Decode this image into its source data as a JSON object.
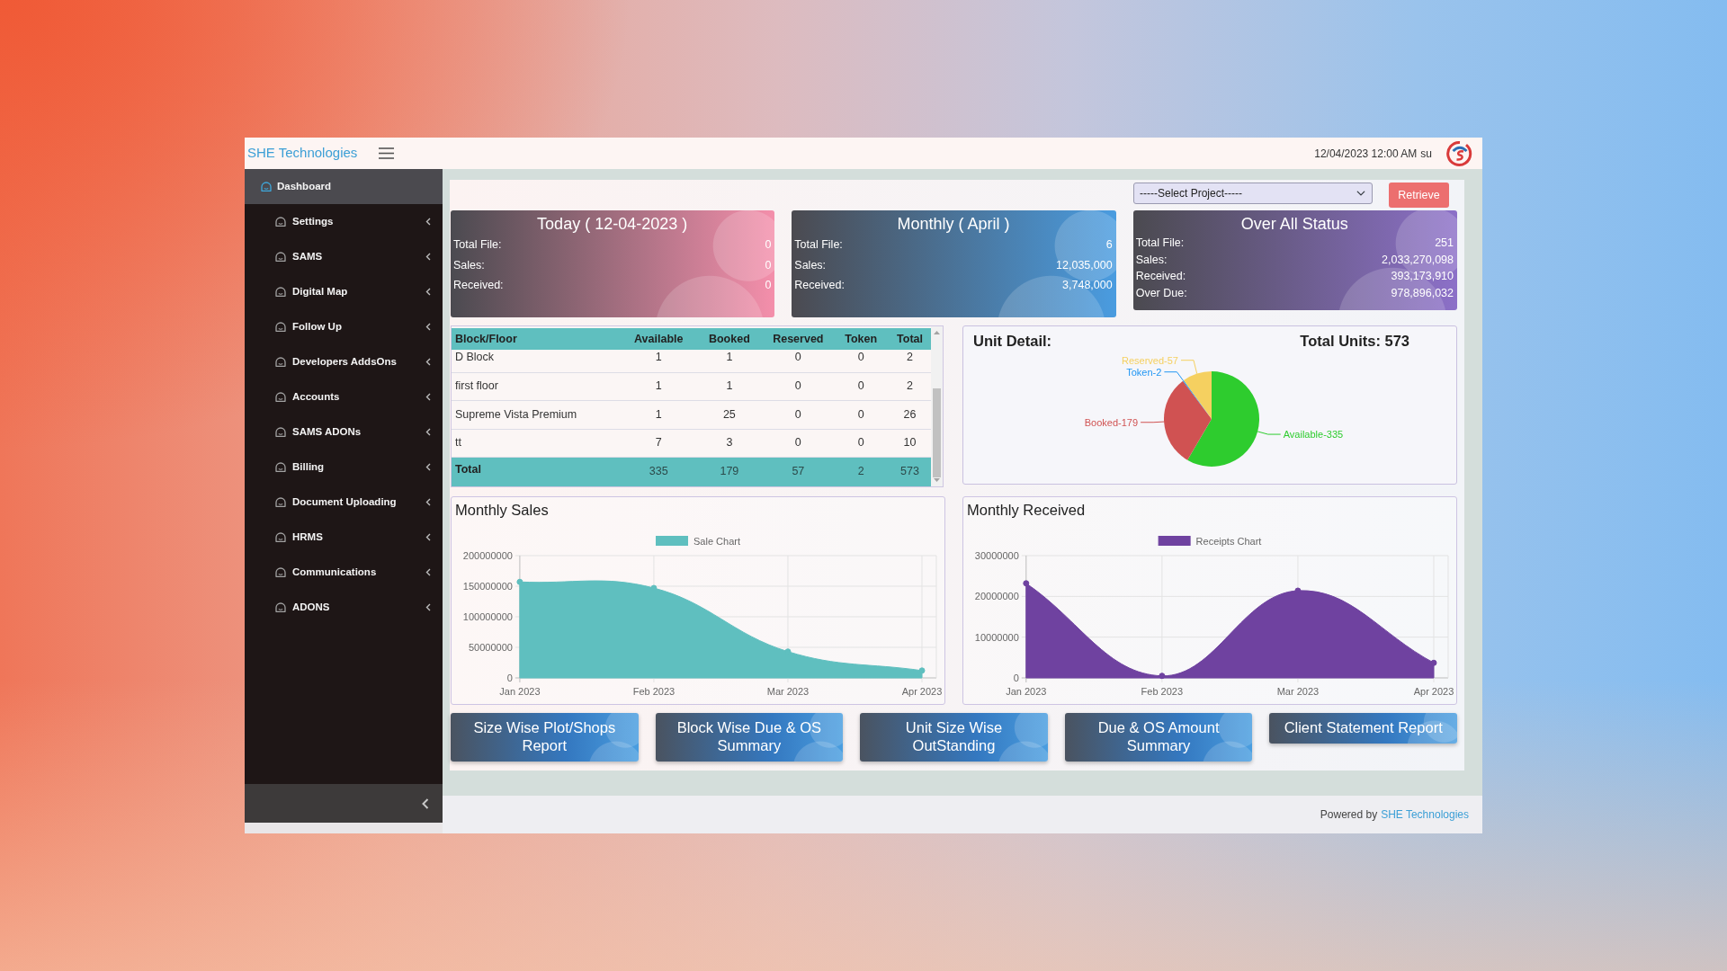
{
  "header": {
    "brand": "SHE Technologies",
    "datetime": "12/04/2023 12:00 AM",
    "user": "su"
  },
  "sidebar": {
    "items": [
      {
        "label": "Dashboard",
        "selected": true,
        "has_submenu": false
      },
      {
        "label": "Settings",
        "selected": false,
        "has_submenu": true
      },
      {
        "label": "SAMS",
        "selected": false,
        "has_submenu": true
      },
      {
        "label": "Digital Map",
        "selected": false,
        "has_submenu": true
      },
      {
        "label": "Follow Up",
        "selected": false,
        "has_submenu": true
      },
      {
        "label": "Developers AddsOns",
        "selected": false,
        "has_submenu": true
      },
      {
        "label": "Accounts",
        "selected": false,
        "has_submenu": true
      },
      {
        "label": "SAMS ADONs",
        "selected": false,
        "has_submenu": true
      },
      {
        "label": "Billing",
        "selected": false,
        "has_submenu": true
      },
      {
        "label": "Document Uploading",
        "selected": false,
        "has_submenu": true
      },
      {
        "label": "HRMS",
        "selected": false,
        "has_submenu": true
      },
      {
        "label": "Communications",
        "selected": false,
        "has_submenu": true
      },
      {
        "label": "ADONS",
        "selected": false,
        "has_submenu": true
      }
    ]
  },
  "toolbar": {
    "project_select": {
      "value": "-----Select Project-----"
    },
    "retrieve_button": "Retrieve"
  },
  "summary_cards": [
    {
      "title": "Today ( 12-04-2023 )",
      "color": "#f48fab",
      "rows": [
        {
          "label": "Total File:",
          "value": "0"
        },
        {
          "label": "Sales:",
          "value": "0"
        },
        {
          "label": "Received:",
          "value": "0"
        }
      ]
    },
    {
      "title": "Monthly ( April )",
      "color": "#4a9ce0",
      "rows": [
        {
          "label": "Total File:",
          "value": "6"
        },
        {
          "label": "Sales:",
          "value": "12,035,000"
        },
        {
          "label": "Received:",
          "value": "3,748,000"
        }
      ]
    },
    {
      "title": "Over All Status",
      "color": "#8c70c8",
      "rows": [
        {
          "label": "Total File:",
          "value": "251"
        },
        {
          "label": "Sales:",
          "value": "2,033,270,098"
        },
        {
          "label": "Received:",
          "value": "393,173,910"
        },
        {
          "label": "Over Due:",
          "value": "978,896,032"
        }
      ]
    }
  ],
  "block_table": {
    "columns": [
      "Block/Floor",
      "Available",
      "Booked",
      "Reserved",
      "Token",
      "Total"
    ],
    "rows": [
      [
        "D Block",
        "1",
        "1",
        "0",
        "0",
        "2"
      ],
      [
        "first floor",
        "1",
        "1",
        "0",
        "0",
        "2"
      ],
      [
        "Supreme Vista Premium",
        "1",
        "25",
        "0",
        "0",
        "26"
      ],
      [
        "tt",
        "7",
        "3",
        "0",
        "0",
        "10"
      ]
    ],
    "total_row": [
      "Total",
      "335",
      "179",
      "57",
      "2",
      "573"
    ]
  },
  "unit_detail": {
    "title": "Unit Detail:",
    "total": "Total Units: 573",
    "chart_data": {
      "type": "pie",
      "categories": [
        "Available-335",
        "Booked-179",
        "Token-2",
        "Reserved-57"
      ],
      "values": [
        58.46,
        31.24,
        0.35,
        9.95
      ],
      "colors": [
        "#2ecc2e",
        "#d05252",
        "#2196f3",
        "#f5d060"
      ]
    }
  },
  "monthly_sales": {
    "title": "Monthly Sales",
    "chart_data": {
      "type": "area",
      "categories": [
        "Jan 2023",
        "Feb 2023",
        "Mar 2023",
        "Apr 2023"
      ],
      "series": [
        {
          "name": "Sale Chart",
          "color": "#5fbfbf",
          "values": [
            157000000,
            147000000,
            43000000,
            12000000
          ]
        }
      ],
      "ylim": [
        0,
        200000000
      ],
      "yticks": [
        0,
        50000000,
        100000000,
        150000000,
        200000000
      ],
      "grid": true
    }
  },
  "monthly_received": {
    "title": "Monthly Received",
    "chart_data": {
      "type": "area",
      "categories": [
        "Jan 2023",
        "Feb 2023",
        "Mar 2023",
        "Apr 2023"
      ],
      "series": [
        {
          "name": "Receipts Chart",
          "color": "#6f42a0",
          "values": [
            23200000,
            500000,
            21400000,
            3700000
          ]
        }
      ],
      "ylim": [
        0,
        30000000
      ],
      "yticks": [
        0,
        10000000,
        20000000,
        30000000
      ],
      "grid": true
    }
  },
  "report_buttons": [
    "Size Wise Plot/Shops Report",
    "Block Wise Due & OS Summary",
    "Unit Size Wise OutStanding",
    "Due & OS Amount Summary",
    "Client Statement Report"
  ],
  "footer": {
    "text": "Powered by",
    "link": "SHE Technologies"
  }
}
